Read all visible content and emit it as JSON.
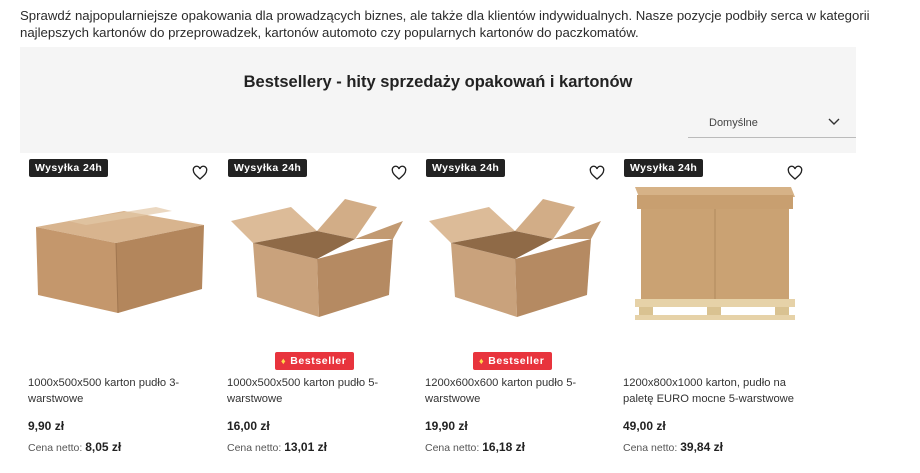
{
  "intro_text": "Sprawdź najpopularniejsze opakowania dla prowadzących biznes, ale także dla klientów indywidualnych. Nasze pozycje podbiły serca w kategorii najlepszych kartonów do przeprowadzek, kartonów automoto czy popularnych kartonów do paczkomatów.",
  "section": {
    "title": "Bestsellery - hity sprzedaży opakowań i kartonów",
    "sort_selected": "Domyślne"
  },
  "products": [
    {
      "shipping_badge": "Wysyłka 24h",
      "bestseller": "",
      "name": "1000x500x500 karton pudło 3-warstwowe",
      "price": "9,90 zł",
      "netto_label": "Cena netto:",
      "netto_value": "8,05 zł",
      "image": "closed-box-icon"
    },
    {
      "shipping_badge": "Wysyłka 24h",
      "bestseller": "Bestseller",
      "name": "1000x500x500 karton pudło 5-warstwowe",
      "price": "16,00 zł",
      "netto_label": "Cena netto:",
      "netto_value": "13,01 zł",
      "image": "open-box-icon"
    },
    {
      "shipping_badge": "Wysyłka 24h",
      "bestseller": "Bestseller",
      "name": "1200x600x600 karton pudło 5-warstwowe",
      "price": "19,90 zł",
      "netto_label": "Cena netto:",
      "netto_value": "16,18 zł",
      "image": "open-box-icon"
    },
    {
      "shipping_badge": "Wysyłka 24h",
      "bestseller": "",
      "name": "1200x800x1000 karton, pudło na paletę EURO mocne 5-warstwowe",
      "price": "49,00 zł",
      "netto_label": "Cena netto:",
      "netto_value": "39,84 zł",
      "image": "pallet-box-icon"
    }
  ],
  "colors": {
    "badge_dark": "#222222",
    "bestseller_red": "#e8343d",
    "panel_bg": "#f5f5f5",
    "cardboard": "#c9a07a"
  }
}
